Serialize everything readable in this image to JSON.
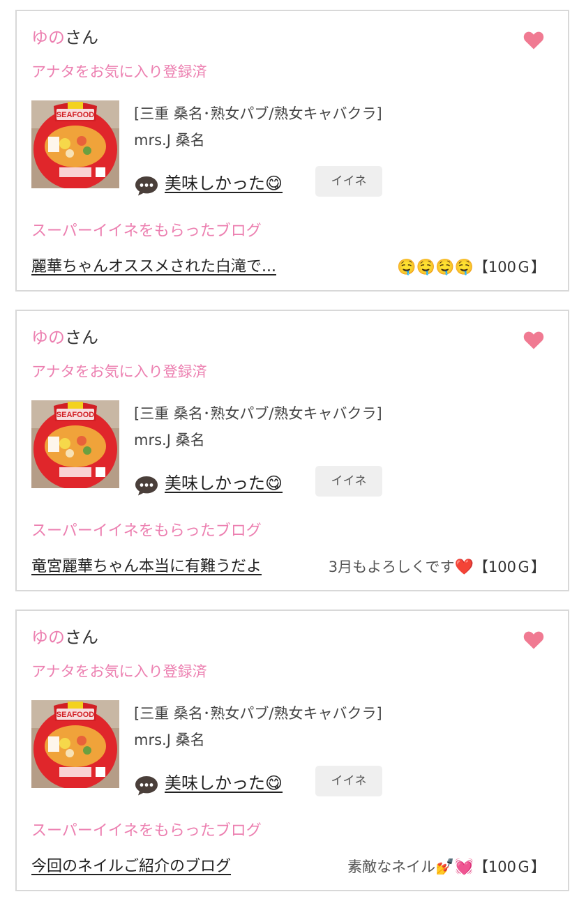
{
  "cards": [
    {
      "user_name": "ゆの",
      "user_suffix": "さん",
      "favorite_status": "アナタをお気に入り登録済",
      "shop_category": "[三重 桑名･熟女パブ/熟女キャバクラ]",
      "shop_name": "mrs.J 桑名",
      "comment": "美味しかった😋",
      "like_label": "イイネ",
      "super_like_title": "スーパーイイネをもらったブログ",
      "blog_title": "麗華ちゃんオススメされた白滝で...",
      "blog_comment": "",
      "blog_emoji": "🤤🤤🤤🤤",
      "points": "【100Ｇ】"
    },
    {
      "user_name": "ゆの",
      "user_suffix": "さん",
      "favorite_status": "アナタをお気に入り登録済",
      "shop_category": "[三重 桑名･熟女パブ/熟女キャバクラ]",
      "shop_name": "mrs.J 桑名",
      "comment": "美味しかった😋",
      "like_label": "イイネ",
      "super_like_title": "スーパーイイネをもらったブログ",
      "blog_title": "竜宮麗華ちゃん本当に有難うだよ",
      "blog_comment": "3月もよろしくです",
      "blog_emoji": "❤️",
      "points": "【100Ｇ】"
    },
    {
      "user_name": "ゆの",
      "user_suffix": "さん",
      "favorite_status": "アナタをお気に入り登録済",
      "shop_category": "[三重 桑名･熟女パブ/熟女キャバクラ]",
      "shop_name": "mrs.J 桑名",
      "comment": "美味しかった😋",
      "like_label": "イイネ",
      "super_like_title": "スーパーイイネをもらったブログ",
      "blog_title": "今回のネイルご紹介のブログ",
      "blog_comment": "素敵なネイル",
      "blog_emoji": "💅💓",
      "points": "【100Ｇ】"
    }
  ],
  "colors": {
    "accent_pink": "#ec7fb0",
    "heart_pink": "#f07a92",
    "card_border": "#d8d8d8",
    "like_button_bg": "#efefef"
  },
  "icons": {
    "heart": "heart-icon",
    "comment": "speech-bubble-icon",
    "thumbnail": "seafood-noodle-cup-photo"
  }
}
